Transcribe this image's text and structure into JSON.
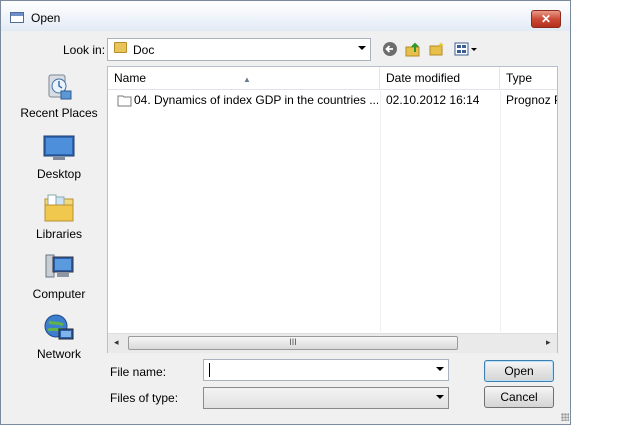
{
  "window": {
    "title": "Open",
    "close_symbol": "✕"
  },
  "toolbar": {
    "look_in_label": "Look in:",
    "look_in_value": "Doc",
    "icons": [
      "back-icon",
      "up-folder-icon",
      "new-folder-icon",
      "views-menu-icon"
    ]
  },
  "places": [
    {
      "label": "Recent Places",
      "icon": "recent-places-icon"
    },
    {
      "label": "Desktop",
      "icon": "desktop-icon"
    },
    {
      "label": "Libraries",
      "icon": "libraries-icon"
    },
    {
      "label": "Computer",
      "icon": "computer-icon"
    },
    {
      "label": "Network",
      "icon": "network-icon"
    }
  ],
  "columns": {
    "name": "Name",
    "date": "Date modified",
    "type": "Type"
  },
  "files": [
    {
      "name": "04. Dynamics of index GDP in the countries ...",
      "date": "02.10.2012 16:14",
      "type": "Prognoz P",
      "icon": "document-icon"
    }
  ],
  "scrollbar": {
    "grip": "III",
    "left_arrow": "◂",
    "right_arrow": "▸"
  },
  "form": {
    "file_name_label": "File name:",
    "file_name_value": "",
    "files_of_type_label": "Files of type:",
    "files_of_type_value": ""
  },
  "buttons": {
    "open": "Open",
    "cancel": "Cancel"
  }
}
